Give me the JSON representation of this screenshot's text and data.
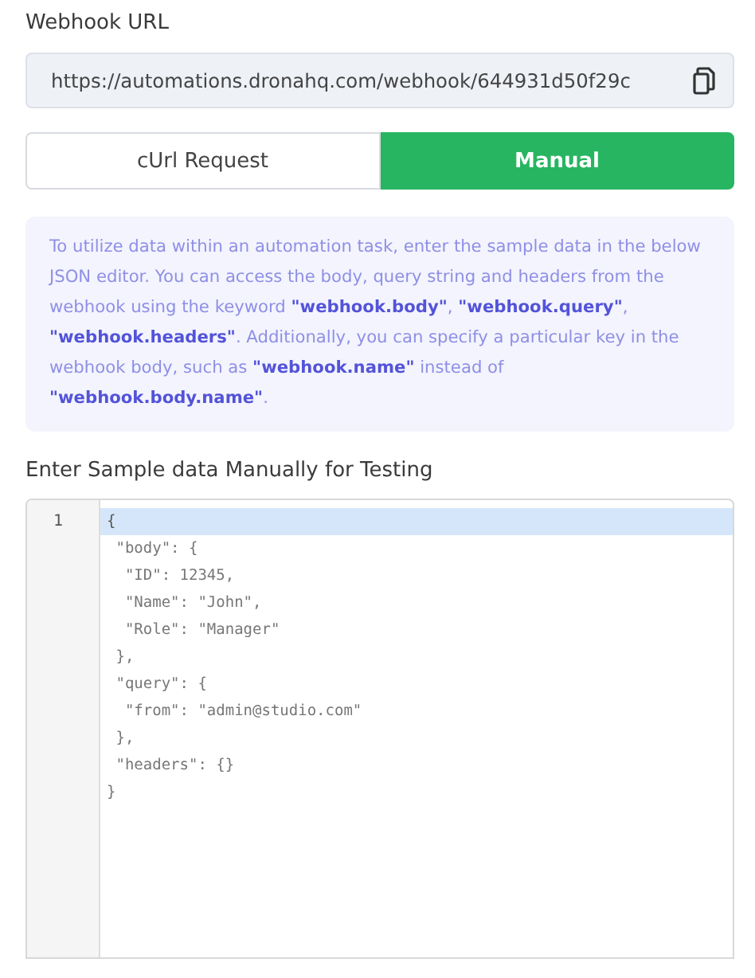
{
  "webhook_url": {
    "label": "Webhook URL",
    "value": "https://automations.dronahq.com/webhook/644931d50f29c"
  },
  "tabs": [
    {
      "label": "cUrl Request",
      "selected": false
    },
    {
      "label": "Manual",
      "selected": true
    }
  ],
  "info": "To utilize data within an automation task, enter the sample data in the below JSON editor. You can access the body, query string and headers from the webhook using the keyword **\"webhook.body\"**, **\"webhook.query\"**, **\"webhook.headers\"**. Additionally, you can specify a particular key in the webhook body, such as **\"webhook.name\"** instead of **\"webhook.body.name\"**.",
  "editor": {
    "label": "Enter Sample data Manually for Testing",
    "line_numbers": [
      "1"
    ],
    "lines": [
      {
        "text": "{",
        "selected": true
      },
      {
        "text": " \"body\": {",
        "selected": false
      },
      {
        "text": "  \"ID\": 12345,",
        "selected": false
      },
      {
        "text": "  \"Name\": \"John\",",
        "selected": false
      },
      {
        "text": "  \"Role\": \"Manager\"",
        "selected": false
      },
      {
        "text": " },",
        "selected": false
      },
      {
        "text": " \"query\": {",
        "selected": false
      },
      {
        "text": "  \"from\": \"admin@studio.com\"",
        "selected": false
      },
      {
        "text": " },",
        "selected": false
      },
      {
        "text": " \"headers\": {}",
        "selected": false
      },
      {
        "text": "}",
        "selected": false
      }
    ]
  }
}
